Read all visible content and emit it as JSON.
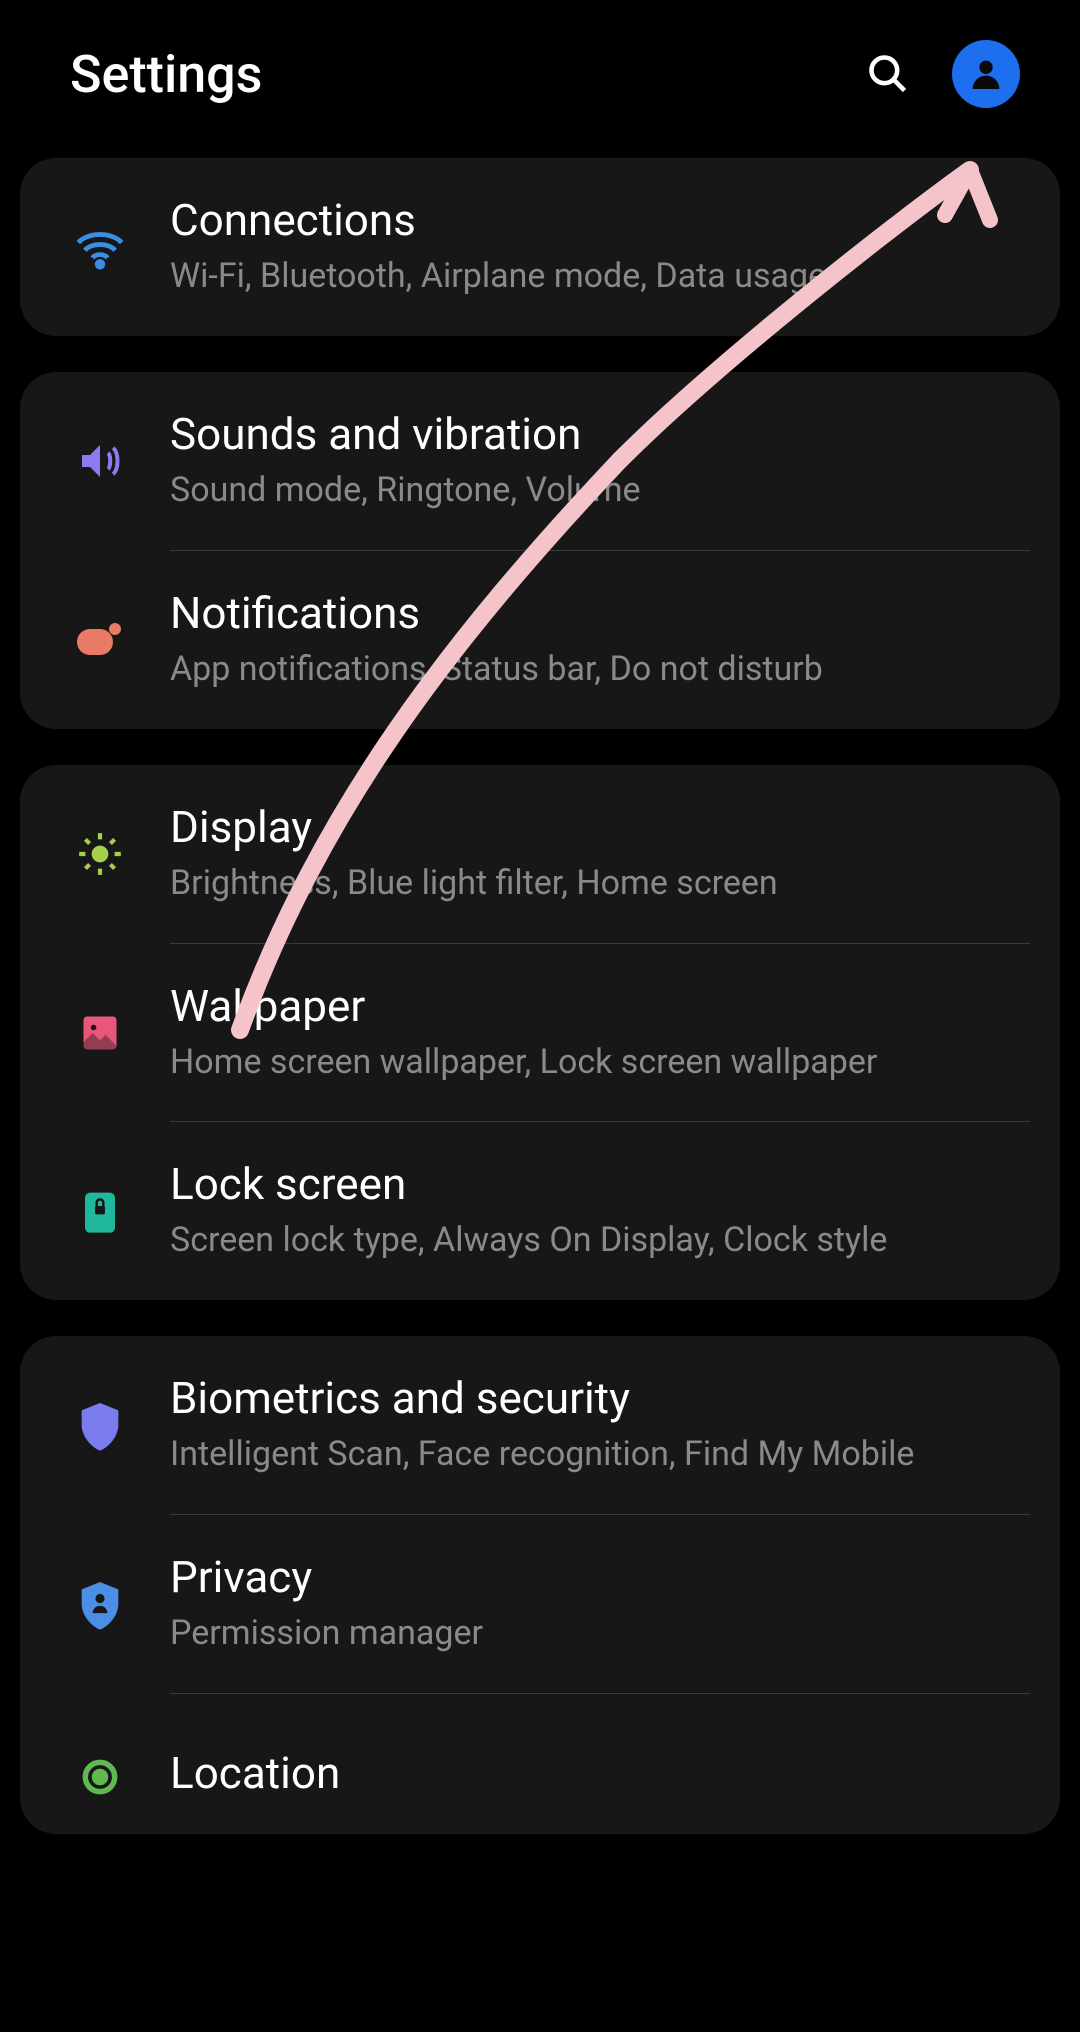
{
  "header": {
    "title": "Settings"
  },
  "groups": [
    {
      "items": [
        {
          "title": "Connections",
          "subtitle": "Wi-Fi, Bluetooth, Airplane mode, Data usage",
          "icon": "wifi",
          "color": "#3a8ee6"
        }
      ]
    },
    {
      "items": [
        {
          "title": "Sounds and vibration",
          "subtitle": "Sound mode, Ringtone, Volume",
          "icon": "sound",
          "color": "#8a7cf0"
        },
        {
          "title": "Notifications",
          "subtitle": "App notifications, Status bar, Do not disturb",
          "icon": "notifications",
          "color": "#e87a66"
        }
      ]
    },
    {
      "items": [
        {
          "title": "Display",
          "subtitle": "Brightness, Blue light filter, Home screen",
          "icon": "display",
          "color": "#a4d14a"
        },
        {
          "title": "Wallpaper",
          "subtitle": "Home screen wallpaper, Lock screen wallpaper",
          "icon": "wallpaper",
          "color": "#e8567a"
        },
        {
          "title": "Lock screen",
          "subtitle": "Screen lock type, Always On Display, Clock style",
          "icon": "lock",
          "color": "#1fb89c"
        }
      ]
    },
    {
      "items": [
        {
          "title": "Biometrics and security",
          "subtitle": "Intelligent Scan, Face recognition, Find My Mobile",
          "icon": "shield",
          "color": "#7a7cf0"
        },
        {
          "title": "Privacy",
          "subtitle": "Permission manager",
          "icon": "privacy",
          "color": "#4a8ee6"
        },
        {
          "title": "Location",
          "subtitle": "",
          "icon": "location",
          "color": "#5fb850"
        }
      ]
    }
  ]
}
